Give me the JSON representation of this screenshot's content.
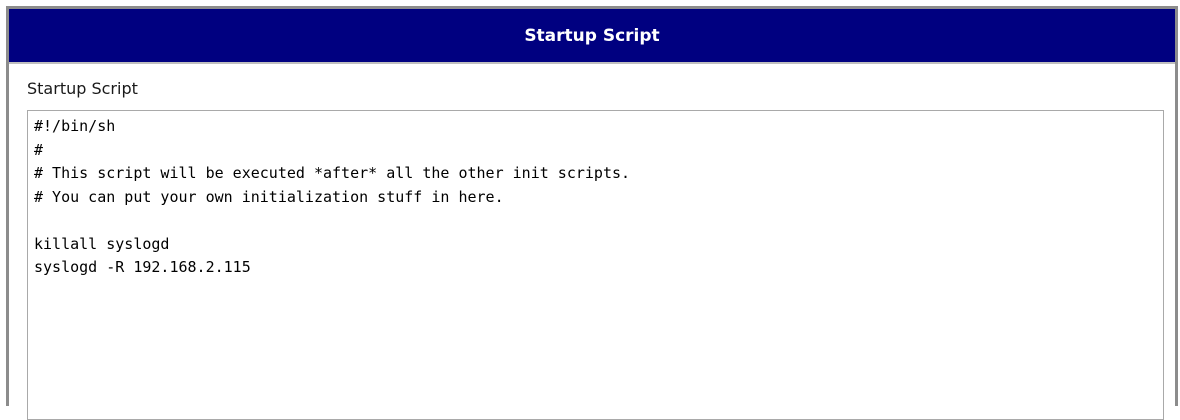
{
  "panel": {
    "title": "Startup Script"
  },
  "form": {
    "label": "Startup Script",
    "script_value": "#!/bin/sh\n#\n# This script will be executed *after* all the other init scripts.\n# You can put your own initialization stuff in here.\n\nkillall syslogd\nsyslogd -R 192.168.2.115"
  },
  "colors": {
    "header_bg": "#000080",
    "header_text": "#ffffff",
    "frame_border": "#8c8c8c"
  }
}
